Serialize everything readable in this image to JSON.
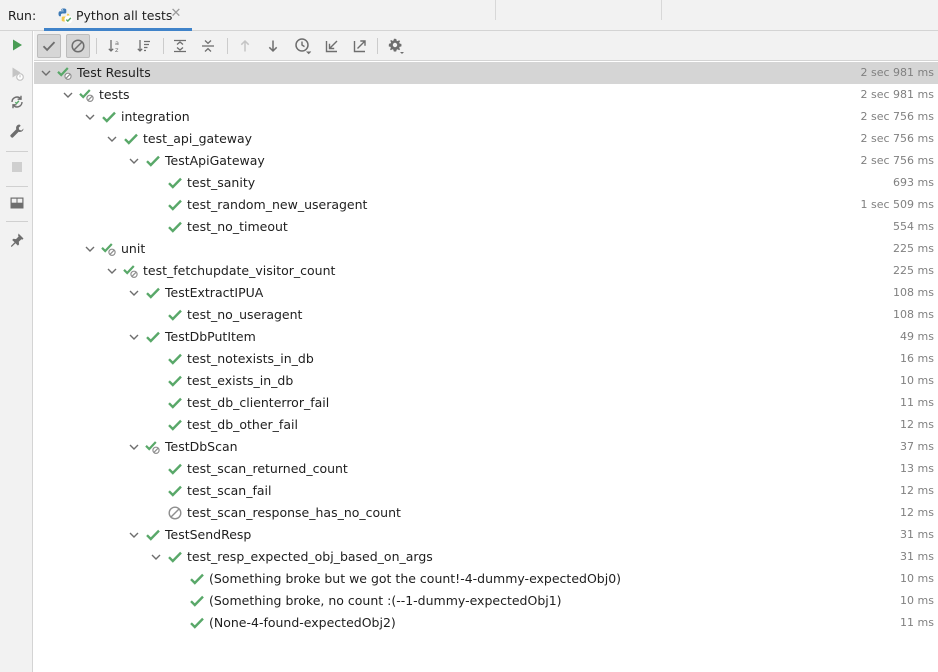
{
  "run_tabs": {
    "run_label": "Run:",
    "active_tab_title": "Python all tests"
  },
  "colors": {
    "pass_green": "#59a869",
    "ignored_gray": "#8e8e8e",
    "accent_blue": "#4083c9",
    "run_green": "#499c54",
    "time_gray": "#808080"
  },
  "sidebar": {
    "buttons": [
      {
        "name": "rerun-icon",
        "enabled": true
      },
      {
        "name": "rerun-failed-icon",
        "enabled": false
      },
      {
        "name": "toggle-auto-test-icon",
        "enabled": true
      },
      {
        "name": "settings-wrench-icon",
        "enabled": true
      },
      {
        "name": "stop-icon",
        "enabled": false
      },
      {
        "name": "layout-icon",
        "enabled": true
      },
      {
        "name": "pin-icon",
        "enabled": true
      }
    ]
  },
  "toolbar": {
    "buttons": [
      {
        "name": "show-passed-icon",
        "toggled": true
      },
      {
        "name": "show-ignored-icon",
        "toggled": true
      },
      {
        "name": "sort-alphabetically-icon",
        "toggled": false
      },
      {
        "name": "sort-by-duration-icon",
        "toggled": false
      },
      {
        "name": "expand-all-icon",
        "toggled": false
      },
      {
        "name": "collapse-all-icon",
        "toggled": false
      },
      {
        "name": "previous-failed-icon",
        "toggled": false
      },
      {
        "name": "next-failed-icon",
        "toggled": false
      },
      {
        "name": "test-history-icon",
        "toggled": false
      },
      {
        "name": "import-tests-icon",
        "toggled": false
      },
      {
        "name": "export-results-icon",
        "toggled": false
      },
      {
        "name": "settings-gear-icon",
        "toggled": false
      }
    ]
  },
  "tree": {
    "rows": [
      {
        "label": "Test Results",
        "time": "2 sec 981 ms",
        "depth": 0,
        "expanded": true,
        "status": "passed-with-ignored",
        "selected": true
      },
      {
        "label": "tests",
        "time": "2 sec 981 ms",
        "depth": 1,
        "expanded": true,
        "status": "passed-with-ignored"
      },
      {
        "label": "integration",
        "time": "2 sec 756 ms",
        "depth": 2,
        "expanded": true,
        "status": "passed"
      },
      {
        "label": "test_api_gateway",
        "time": "2 sec 756 ms",
        "depth": 3,
        "expanded": true,
        "status": "passed"
      },
      {
        "label": "TestApiGateway",
        "time": "2 sec 756 ms",
        "depth": 4,
        "expanded": true,
        "status": "passed"
      },
      {
        "label": "test_sanity",
        "time": "693 ms",
        "depth": 5,
        "status": "passed"
      },
      {
        "label": "test_random_new_useragent",
        "time": "1 sec 509 ms",
        "depth": 5,
        "status": "passed"
      },
      {
        "label": "test_no_timeout",
        "time": "554 ms",
        "depth": 5,
        "status": "passed"
      },
      {
        "label": "unit",
        "time": "225 ms",
        "depth": 2,
        "expanded": true,
        "status": "passed-with-ignored"
      },
      {
        "label": "test_fetchupdate_visitor_count",
        "time": "225 ms",
        "depth": 3,
        "expanded": true,
        "status": "passed-with-ignored"
      },
      {
        "label": "TestExtractIPUA",
        "time": "108 ms",
        "depth": 4,
        "expanded": true,
        "status": "passed"
      },
      {
        "label": "test_no_useragent",
        "time": "108 ms",
        "depth": 5,
        "status": "passed"
      },
      {
        "label": "TestDbPutItem",
        "time": "49 ms",
        "depth": 4,
        "expanded": true,
        "status": "passed"
      },
      {
        "label": "test_notexists_in_db",
        "time": "16 ms",
        "depth": 5,
        "status": "passed"
      },
      {
        "label": "test_exists_in_db",
        "time": "10 ms",
        "depth": 5,
        "status": "passed"
      },
      {
        "label": "test_db_clienterror_fail",
        "time": "11 ms",
        "depth": 5,
        "status": "passed"
      },
      {
        "label": "test_db_other_fail",
        "time": "12 ms",
        "depth": 5,
        "status": "passed"
      },
      {
        "label": "TestDbScan",
        "time": "37 ms",
        "depth": 4,
        "expanded": true,
        "status": "passed-with-ignored"
      },
      {
        "label": "test_scan_returned_count",
        "time": "13 ms",
        "depth": 5,
        "status": "passed"
      },
      {
        "label": "test_scan_fail",
        "time": "12 ms",
        "depth": 5,
        "status": "passed"
      },
      {
        "label": "test_scan_response_has_no_count",
        "time": "12 ms",
        "depth": 5,
        "status": "ignored"
      },
      {
        "label": "TestSendResp",
        "time": "31 ms",
        "depth": 4,
        "expanded": true,
        "status": "passed"
      },
      {
        "label": "test_resp_expected_obj_based_on_args",
        "time": "31 ms",
        "depth": 5,
        "expanded": true,
        "status": "passed"
      },
      {
        "label": "(Something broke but we got the count!-4-dummy-expectedObj0)",
        "time": "10 ms",
        "depth": 6,
        "status": "passed"
      },
      {
        "label": "(Something broke, no count :(--1-dummy-expectedObj1)",
        "time": "10 ms",
        "depth": 6,
        "status": "passed"
      },
      {
        "label": "(None-4-found-expectedObj2)",
        "time": "11 ms",
        "depth": 6,
        "status": "passed"
      }
    ]
  }
}
